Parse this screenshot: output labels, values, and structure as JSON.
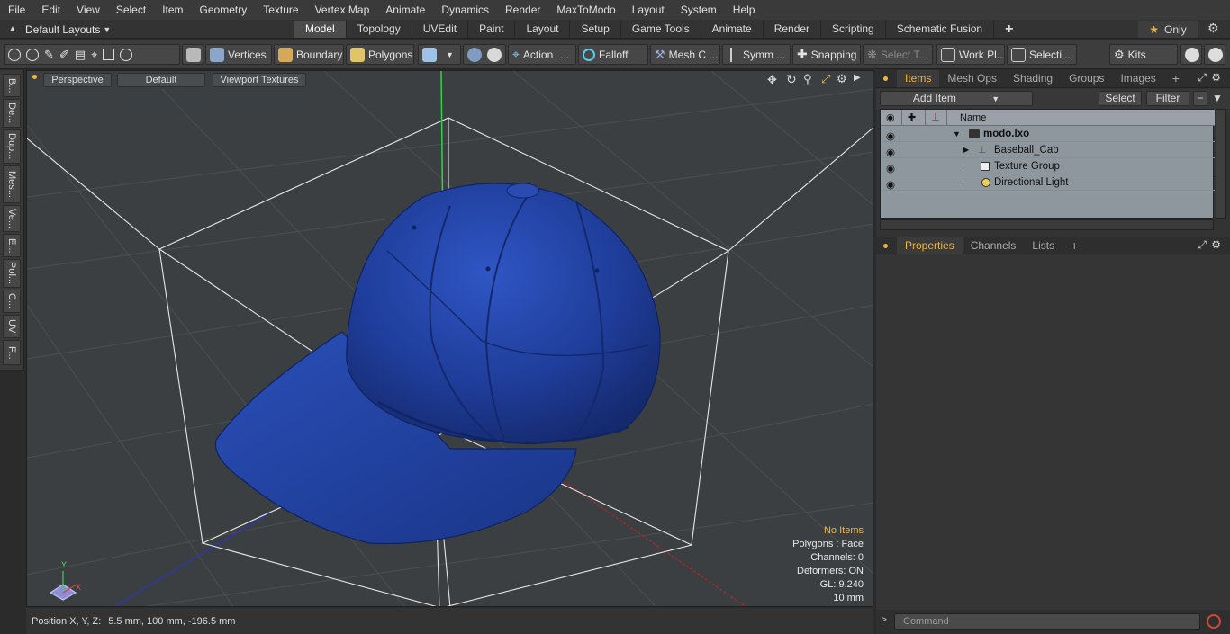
{
  "menu": [
    "File",
    "Edit",
    "View",
    "Select",
    "Item",
    "Geometry",
    "Texture",
    "Vertex Map",
    "Animate",
    "Dynamics",
    "Render",
    "MaxToModo",
    "Layout",
    "System",
    "Help"
  ],
  "layout_dropdown": "Default Layouts",
  "tabs": [
    "Model",
    "Topology",
    "UVEdit",
    "Paint",
    "Layout",
    "Setup",
    "Game Tools",
    "Animate",
    "Render",
    "Scripting",
    "Schematic Fusion"
  ],
  "active_tab": "Model",
  "only_label": "Only",
  "toolbar": {
    "vertices": "Vertices",
    "boundary": "Boundary",
    "polygons": "Polygons",
    "action": "Action",
    "falloff": "Falloff",
    "meshc": "Mesh C ...",
    "symm": "Symm ...",
    "snapping": "Snapping",
    "select_t": "Select T...",
    "workpl": "Work Pl...",
    "selecti": "Selecti ...",
    "kits": "Kits"
  },
  "left_tabs": [
    "B...",
    "De...",
    "Dup...",
    "Mes...",
    "Ve...",
    "E...",
    "Pol...",
    "C...",
    "UV",
    "F..."
  ],
  "viewport": {
    "view": "Perspective",
    "shading": "Default",
    "textures": "Viewport Textures",
    "stats": {
      "no_items": "No Items",
      "polygons": "Polygons : Face",
      "channels": "Channels: 0",
      "deformers": "Deformers: ON",
      "gl": "GL: 9,240",
      "scale": "10 mm"
    },
    "axis_labels": {
      "x": "X",
      "y": "Y"
    }
  },
  "status": {
    "position_label": "Position X, Y, Z:",
    "position_value": "5.5 mm, 100 mm, -196.5 mm"
  },
  "items_panel": {
    "tabs": [
      "Items",
      "Mesh Ops",
      "Shading",
      "Groups",
      "Images"
    ],
    "active": "Items",
    "add_item": "Add Item",
    "select": "Select",
    "filter": "Filter",
    "name_header": "Name",
    "rows": [
      {
        "name": "modo.lxo",
        "bold": true
      },
      {
        "name": "Baseball_Cap"
      },
      {
        "name": "Texture Group"
      },
      {
        "name": "Directional Light"
      }
    ]
  },
  "props_panel": {
    "tabs": [
      "Properties",
      "Channels",
      "Lists"
    ],
    "active": "Properties"
  },
  "command": {
    "placeholder": "Command"
  },
  "colors": {
    "accent": "#f0b53c",
    "cap": "#1f3d9a",
    "grid": "#4a4d50"
  }
}
